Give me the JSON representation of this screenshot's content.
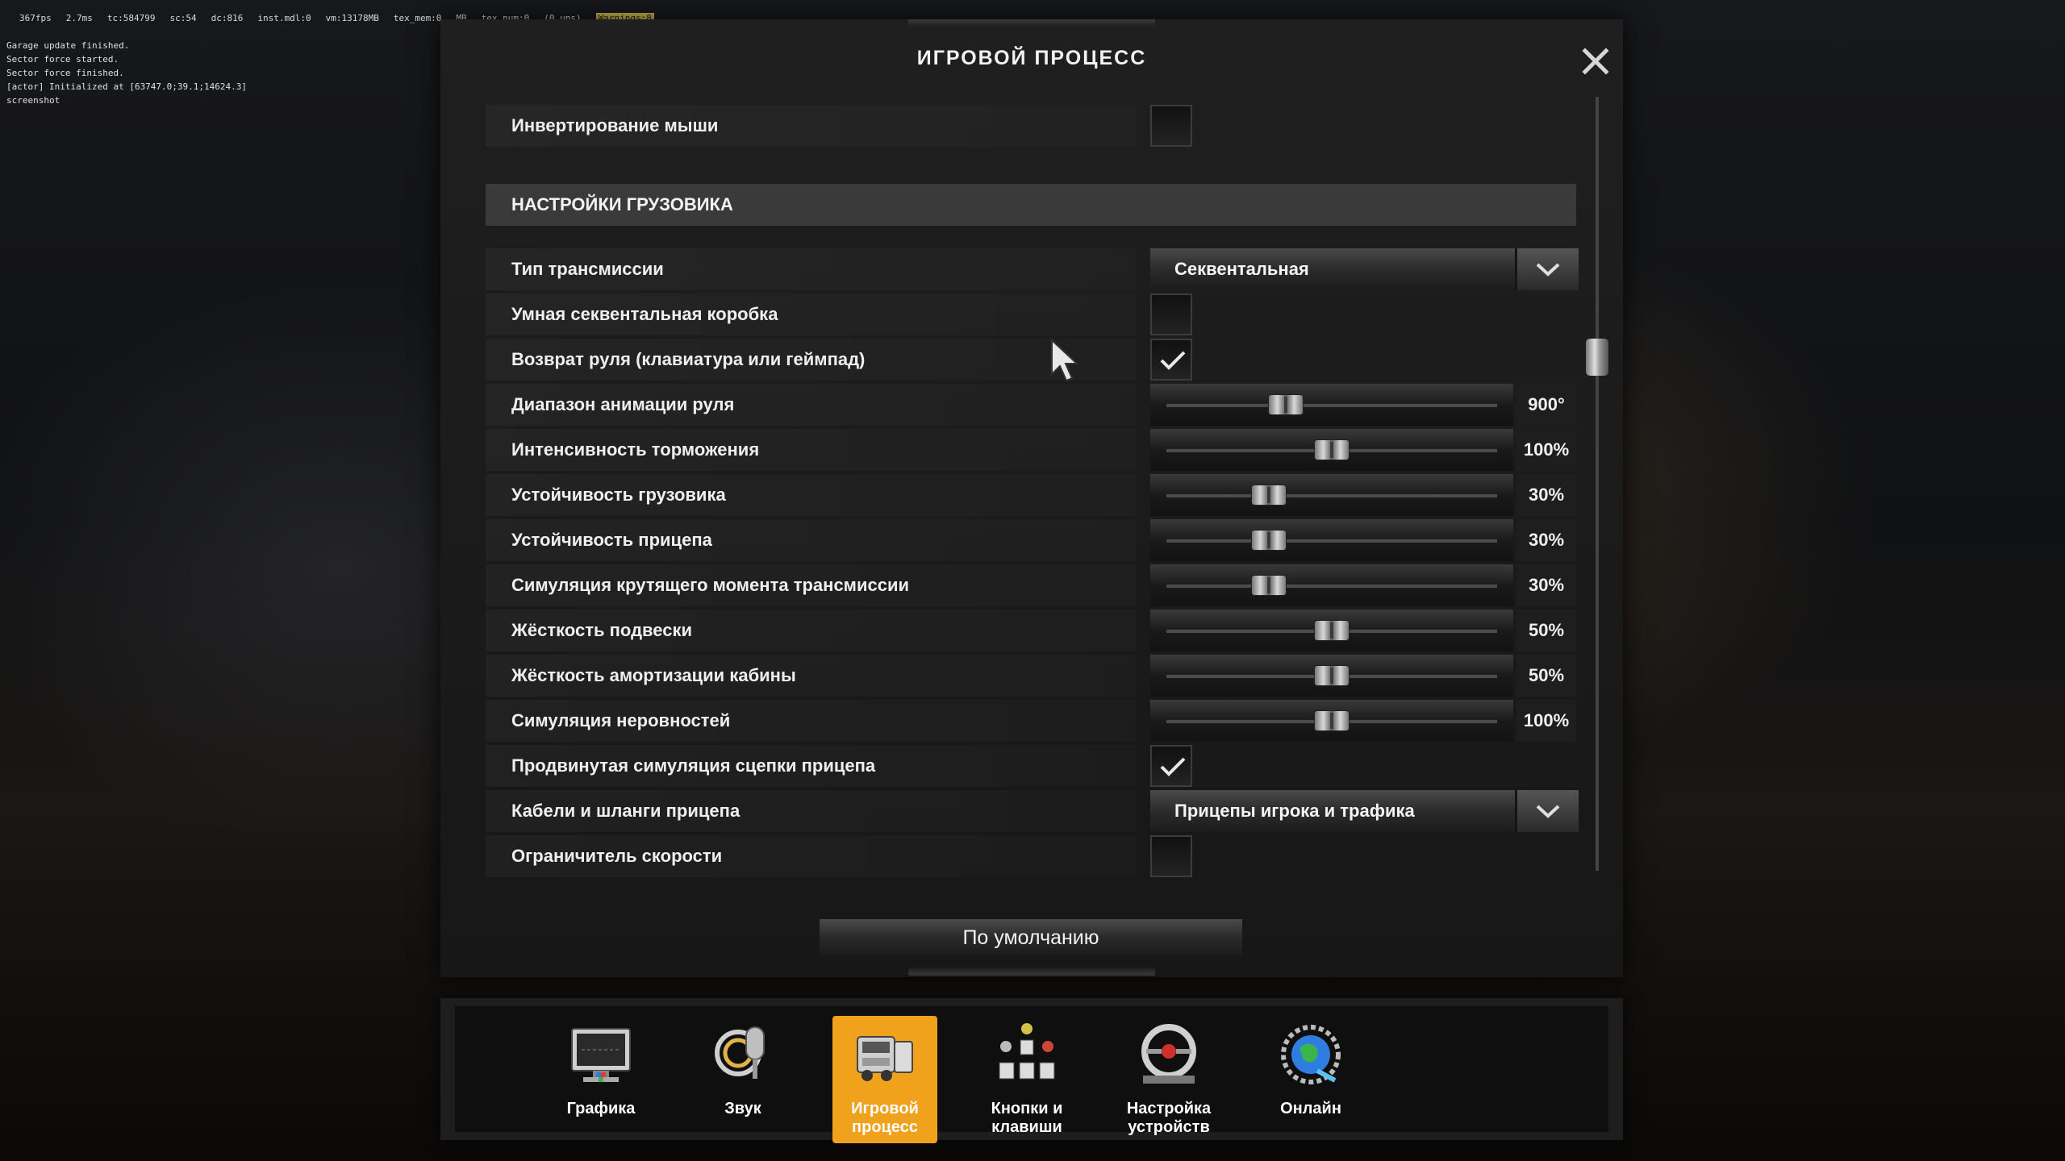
{
  "debug": {
    "items": [
      "367fps",
      "2.7ms",
      "tc:584799",
      "sc:54",
      "dc:816",
      "inst.mdl:0",
      "vm:13178MB",
      "tex_mem:0",
      "MB",
      "tex_num:0",
      "(0 ups)"
    ],
    "warning": "Warnings:8"
  },
  "log": [
    "Garage update finished.",
    "Sector force started.",
    "Sector force finished.",
    "[actor] Initialized at [63747.0;39.1;14624.3]",
    "screenshot"
  ],
  "dialog": {
    "title": "ИГРОВОЙ ПРОЦЕСС",
    "close_icon": "close-icon",
    "default_button": "По умолчанию"
  },
  "settings": {
    "invert_mouse": {
      "label": "Инвертирование мыши",
      "checked": false
    },
    "section_title": "НАСТРОЙКИ ГРУЗОВИКА",
    "transmission": {
      "label": "Тип трансмиссии",
      "value": "Секвентальная"
    },
    "smart_box": {
      "label": "Умная секвентальная коробка",
      "checked": false
    },
    "wheel_return": {
      "label": "Возврат руля (клавиатура или геймпад)",
      "checked": true
    },
    "sliders": [
      {
        "label": "Диапазон анимации руля",
        "value": "900°",
        "level": 0.36
      },
      {
        "label": "Интенсивность торможения",
        "value": "100%",
        "level": 0.5
      },
      {
        "label": "Устойчивость грузовика",
        "value": "30%",
        "level": 0.31
      },
      {
        "label": "Устойчивость прицепа",
        "value": "30%",
        "level": 0.31
      },
      {
        "label": "Симуляция крутящего момента трансмиссии",
        "value": "30%",
        "level": 0.31
      },
      {
        "label": "Жёсткость подвески",
        "value": "50%",
        "level": 0.5
      },
      {
        "label": "Жёсткость амортизации кабины",
        "value": "50%",
        "level": 0.5
      },
      {
        "label": "Симуляция неровностей",
        "value": "100%",
        "level": 0.5
      }
    ],
    "advanced_coupling": {
      "label": "Продвинутая симуляция сцепки прицепа",
      "checked": true
    },
    "cables": {
      "label": "Кабели и шланги прицепа",
      "value": "Прицепы игрока и трафика"
    },
    "speed_limiter": {
      "label": "Ограничитель скорости",
      "checked": false
    }
  },
  "tabs": [
    {
      "label": "Графика",
      "icon": "monitor-icon",
      "active": false
    },
    {
      "label": "Звук",
      "icon": "microphone-icon",
      "active": false
    },
    {
      "label": "Игровой процесс",
      "icon": "truck-icon",
      "active": true
    },
    {
      "label": "Кнопки и клавиши",
      "icon": "gamepad-buttons-icon",
      "active": false
    },
    {
      "label": "Настройка устройств",
      "icon": "steering-wheel-icon",
      "active": false
    },
    {
      "label": "Онлайн",
      "icon": "globe-icon",
      "active": false
    }
  ],
  "colors": {
    "accent": "#f0a21c",
    "panel": "#1f1f1f",
    "section": "#3a3a3a"
  }
}
